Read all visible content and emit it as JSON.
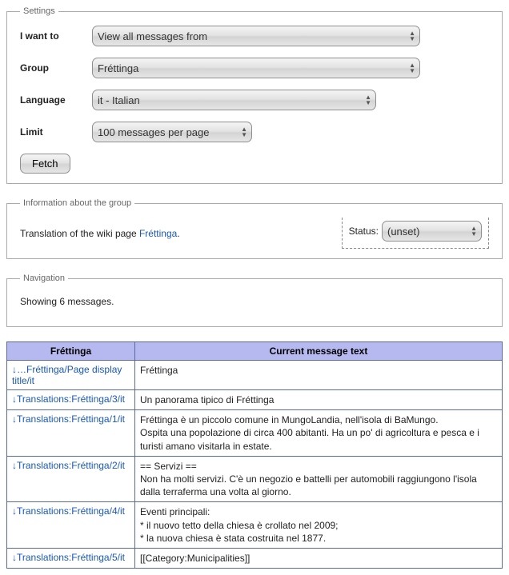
{
  "settings": {
    "legend": "Settings",
    "iwantto_label": "I want to",
    "iwantto_value": "View all messages from",
    "group_label": "Group",
    "group_value": "Fréttinga",
    "language_label": "Language",
    "language_value": "it - Italian",
    "limit_label": "Limit",
    "limit_value": "100 messages per page",
    "fetch": "Fetch"
  },
  "info": {
    "legend": "Information about the group",
    "text_prefix": "Translation of the wiki page ",
    "link": "Fréttinga",
    "text_suffix": ".",
    "status_label": "Status:",
    "status_value": "(unset)"
  },
  "nav": {
    "legend": "Navigation",
    "showing": "Showing 6 messages."
  },
  "table": {
    "col1": "Fréttinga",
    "col2": "Current message text",
    "rows": [
      {
        "link": "…Fréttinga/Page display title/it",
        "text": "Fréttinga"
      },
      {
        "link": "Translations:Fréttinga/3/it",
        "text": "Un panorama tipico di Fréttinga"
      },
      {
        "link": "Translations:Fréttinga/1/it",
        "text": "Fréttinga è un piccolo comune in MungoLandia, nell'isola di BaMungo.\nOspita una popolazione di circa 400 abitanti. Ha un po' di agricoltura e pesca e i turisti amano visitarla in estate."
      },
      {
        "link": "Translations:Fréttinga/2/it",
        "text": "== Servizi ==\nNon ha molti servizi. C'è un negozio e battelli per automobili raggiungono l'isola dalla terraferma una volta al giorno."
      },
      {
        "link": "Translations:Fréttinga/4/it",
        "text": "Eventi principali:\n* il nuovo tetto della chiesa è crollato nel 2009;\n* la nuova chiesa è stata costruita nel 1877."
      },
      {
        "link": "Translations:Fréttinga/5/it",
        "text": "[[Category:Municipalities]]"
      }
    ]
  }
}
